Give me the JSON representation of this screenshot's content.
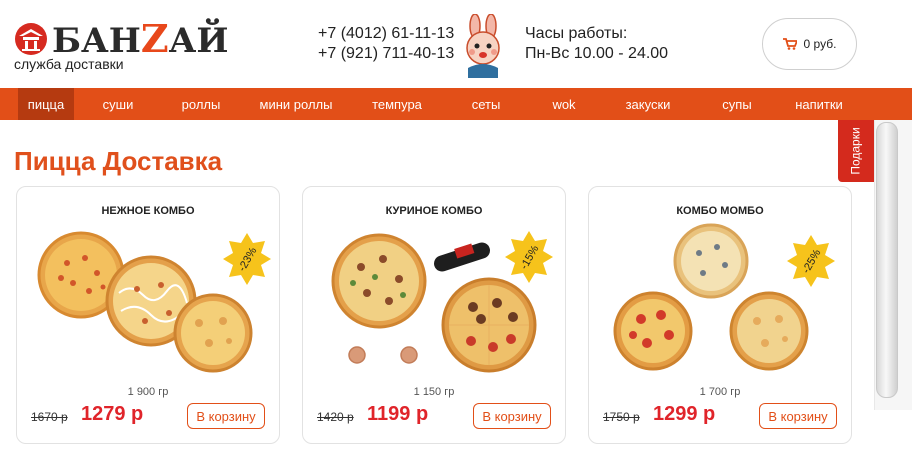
{
  "header": {
    "logo_text_a": "БАН",
    "logo_text_z": "Z",
    "logo_text_b": "АЙ",
    "logo_subtitle": "служба доставки",
    "phones": [
      "+7 (4012) 61-11-13",
      "+7 (921) 711-40-13"
    ],
    "hours_title": "Часы работы:",
    "hours_value": "Пн-Вс 10.00 - 24.00",
    "cart_label": "0 руб."
  },
  "nav": {
    "items": [
      {
        "label": "пицца",
        "active": true
      },
      {
        "label": "суши",
        "active": false
      },
      {
        "label": "роллы",
        "active": false
      },
      {
        "label": "мини роллы",
        "active": false
      },
      {
        "label": "темпура",
        "active": false
      },
      {
        "label": "сеты",
        "active": false
      },
      {
        "label": "wok",
        "active": false
      },
      {
        "label": "закуски",
        "active": false
      },
      {
        "label": "супы",
        "active": false
      },
      {
        "label": "напитки",
        "active": false
      }
    ]
  },
  "side": {
    "tab_label": "Подарки"
  },
  "page": {
    "title": "Пицца Доставка"
  },
  "products": [
    {
      "title": "НЕЖНОЕ КОМБО",
      "discount": "-23%",
      "weight": "1 900 гр",
      "old_price": "1670 р",
      "price": "1279 р",
      "button": "В корзину"
    },
    {
      "title": "КУРИНОЕ КОМБО",
      "discount": "-15%",
      "weight": "1 150 гр",
      "old_price": "1420 р",
      "price": "1199 р",
      "button": "В корзину"
    },
    {
      "title": "КОМБО МОМБО",
      "discount": "-25%",
      "weight": "1 700 гр",
      "old_price": "1750 р",
      "price": "1299 р",
      "button": "В корзину"
    }
  ],
  "colors": {
    "brand_orange": "#e24f18",
    "nav_active": "#b53a10",
    "price_red": "#e0242a",
    "badge_yellow": "#f6c31b"
  },
  "icons": [
    "logo-pagoda-icon",
    "bunny-mascot-icon",
    "cart-icon",
    "discount-starburst-icon",
    "pizza-icon",
    "cola-bottle-icon",
    "sauce-cup-icon"
  ]
}
